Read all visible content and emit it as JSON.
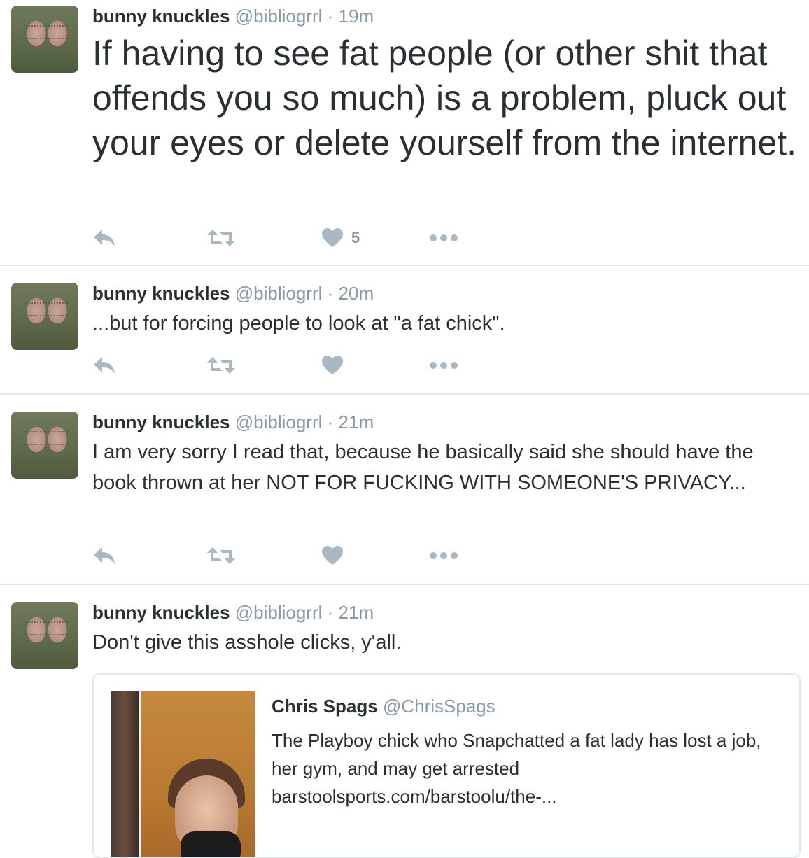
{
  "tweets": [
    {
      "name": "bunny knuckles",
      "handle": "@bibliogrrl",
      "separator": "·",
      "time": "19m",
      "text": "If having to see fat people (or other shit that offends you so much) is a problem, pluck out your eyes or delete yourself from the internet.",
      "like_count": "5"
    },
    {
      "name": "bunny knuckles",
      "handle": "@bibliogrrl",
      "separator": "·",
      "time": "20m",
      "text": "...but for forcing people to look at \"a fat chick\"."
    },
    {
      "name": "bunny knuckles",
      "handle": "@bibliogrrl",
      "separator": "·",
      "time": "21m",
      "text": "I am very sorry I read that, because he basically said she should have the book thrown at her NOT FOR FUCKING WITH SOMEONE'S PRIVACY..."
    },
    {
      "name": "bunny knuckles",
      "handle": "@bibliogrrl",
      "separator": "·",
      "time": "21m",
      "text": "Don't give this asshole clicks, y'all.",
      "quoted": {
        "name": "Chris Spags",
        "handle": "@ChrisSpags",
        "text": "The Playboy chick who Snapchatted a fat lady has lost a job, her gym, and may get arrested",
        "link": "barstoolsports.com/barstoolu/the-..."
      }
    }
  ],
  "icons": {
    "reply": "reply-icon",
    "retweet": "retweet-icon",
    "like": "heart-icon",
    "more": "more-dots-icon"
  },
  "colors": {
    "name": "#292f33",
    "meta": "#8899a6",
    "action_icon": "#aab8c2",
    "divider": "#e1e8ed"
  }
}
